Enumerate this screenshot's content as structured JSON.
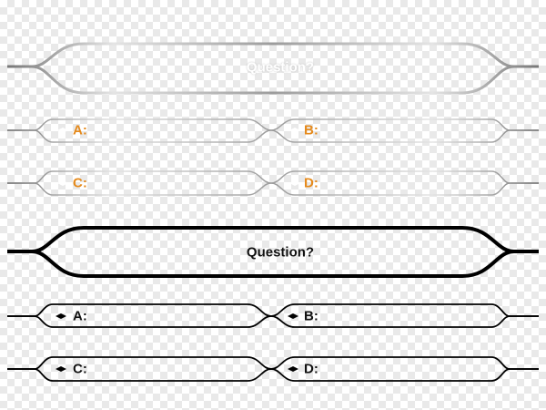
{
  "sets": [
    {
      "style": "silver",
      "question": "Question?",
      "options": [
        "A:",
        "B:",
        "C:",
        "D:"
      ],
      "label_color": "#e58a1c",
      "frame_color": "#9a9a9a"
    },
    {
      "style": "dark",
      "question": "Question?",
      "options": [
        "A:",
        "B:",
        "C:",
        "D:"
      ],
      "label_color": "#111111",
      "frame_color": "#000000"
    }
  ]
}
